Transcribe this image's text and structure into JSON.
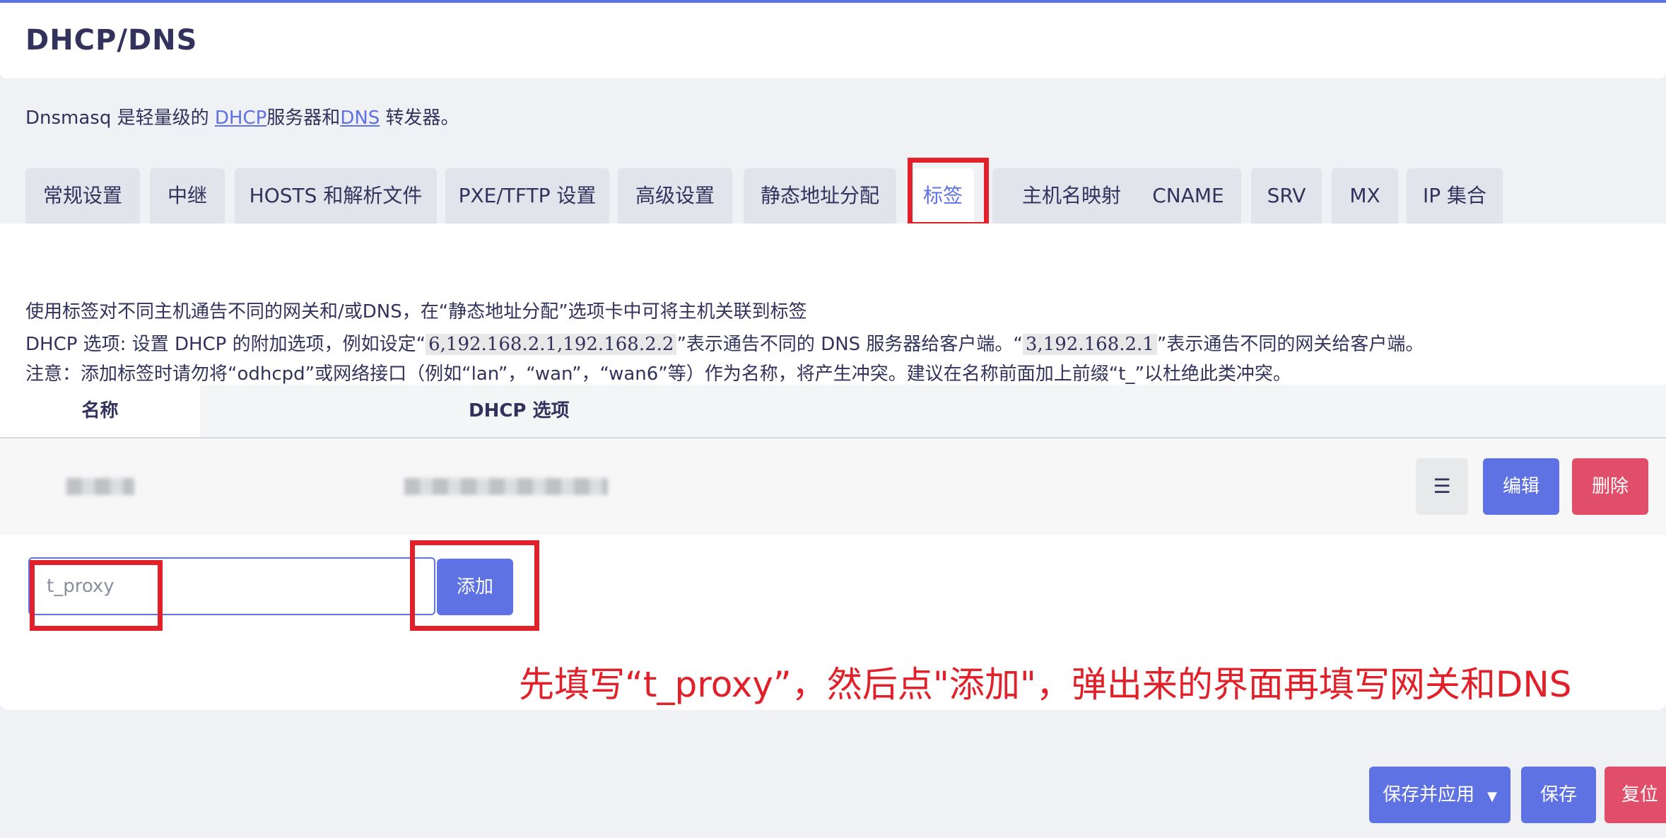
{
  "page": {
    "title": "DHCP/DNS"
  },
  "description": {
    "prefix": "Dnsmasq 是轻量级的 ",
    "link_dhcp": "DHCP",
    "middle": "服务器和",
    "link_dns": "DNS",
    "suffix": " 转发器。"
  },
  "tabs": [
    {
      "label": "常规设置"
    },
    {
      "label": "中继"
    },
    {
      "label": "HOSTS 和解析文件"
    },
    {
      "label": "PXE/TFTP 设置"
    },
    {
      "label": "高级设置"
    },
    {
      "label": "静态地址分配"
    },
    {
      "label": "标签",
      "active": true
    },
    {
      "label": "主机名映射"
    },
    {
      "label": "CNAME"
    },
    {
      "label": "SRV"
    },
    {
      "label": "MX"
    },
    {
      "label": "IP 集合"
    }
  ],
  "help": {
    "line1": "使用标签对不同主机通告不同的网关和/或DNS，在“静态地址分配”选项卡中可将主机关联到标签",
    "line2_a": "DHCP 选项: 设置 DHCP 的附加选项，例如设定“",
    "line2_code1": "6,192.168.2.1,192.168.2.2",
    "line2_b": "”表示通告不同的 DNS 服务器给客户端。“",
    "line2_code2": "3,192.168.2.1",
    "line2_c": "”表示通告不同的网关给客户端。",
    "line3": "注意：添加标签时请勿将“odhcpd”或网络接口（例如“lan”，“wan”，“wan6”等）作为名称，将产生冲突。建议在名称前面加上前缀“t_”以杜绝此类冲突。"
  },
  "table": {
    "col_name": "名称",
    "col_options": "DHCP 选项",
    "row": {
      "menu_label": "☰",
      "edit_label": "编辑",
      "delete_label": "删除"
    }
  },
  "add": {
    "placeholder": "t_proxy",
    "button_label": "添加"
  },
  "annotation": "先填写“t_proxy”，然后点\"添加\"，弹出来的界面再填写网关和DNS",
  "footer": {
    "apply_label": "保存并应用",
    "apply_caret": "▼",
    "save_label": "保存",
    "reset_label": "复位"
  },
  "colors": {
    "accent": "#5e72e4",
    "danger": "#e14e6a",
    "highlight": "#e1202a"
  }
}
